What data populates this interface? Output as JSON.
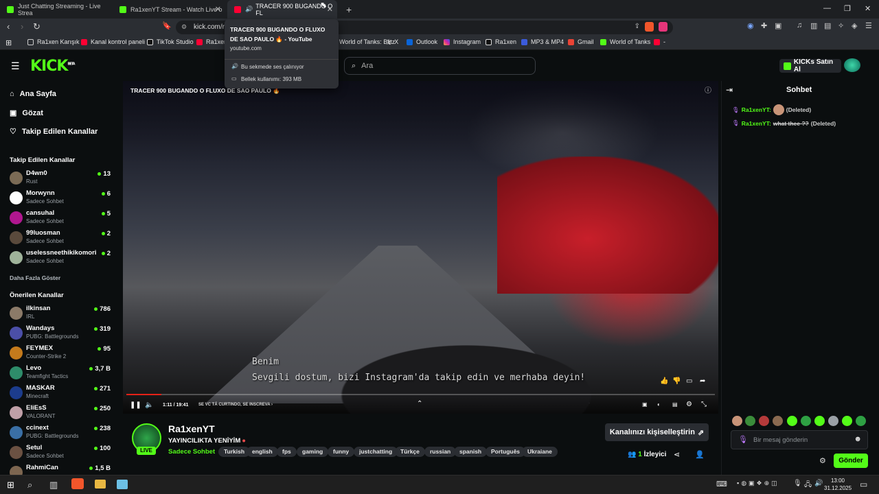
{
  "browser": {
    "tabs": [
      {
        "title": "Just Chatting Streaming - Live Strea",
        "color": "#53fc18"
      },
      {
        "title": "Ra1xenYT Stream - Watch Live o",
        "color": "#53fc18"
      },
      {
        "title": "TRACER 900 BUGANDO O FL",
        "color": "#ff0033"
      }
    ],
    "new_tab_label": "+",
    "url": "kick.com/ra",
    "bookmarks": [
      "Ra1xen Karışık",
      "Kanal kontrol paneli",
      "TikTok Studio",
      "Ra1xen",
      "World of Tanks: Blitz",
      "X",
      "Outlook",
      "Instagram",
      "Ra1xen",
      "MP3 & MP4",
      "Gmail",
      "World of Tanks",
      "-"
    ]
  },
  "tooltip": {
    "title": "TRACER 900 BUGANDO O FLUXO DE SAO PAULO 🔥 - YouTube",
    "site": "youtube.com",
    "audio": "Bu sekmede ses çalınıyor",
    "memory": "Bellek kullanımı: 393 MB"
  },
  "header": {
    "logo": "KICK",
    "logo_badge": "BETA",
    "search_placeholder": "Ara",
    "kicks_button": "KICKs Satın Al"
  },
  "sidebar": {
    "nav": [
      "Ana Sayfa",
      "Gözat",
      "Takip Edilen Kanallar"
    ],
    "followed_heading": "Takip Edilen Kanallar",
    "followed": [
      {
        "name": "D4wn0",
        "category": "Rust",
        "viewers": "13"
      },
      {
        "name": "Morwynn",
        "category": "Sadece Sohbet",
        "viewers": "6"
      },
      {
        "name": "cansuhal",
        "category": "Sadece Sohbet",
        "viewers": "5"
      },
      {
        "name": "99luosman",
        "category": "Sadece Sohbet",
        "viewers": "2"
      },
      {
        "name": "uselessneethikikomori",
        "category": "Sadece Sohbet",
        "viewers": "2"
      }
    ],
    "show_more": "Daha Fazla Göster",
    "recommended_heading": "Önerilen Kanallar",
    "recommended": [
      {
        "name": "ilkinsan",
        "category": "IRL",
        "viewers": "786"
      },
      {
        "name": "Wandays",
        "category": "PUBG: Battlegrounds",
        "viewers": "319"
      },
      {
        "name": "FEYMEX",
        "category": "Counter-Strike 2",
        "viewers": "95"
      },
      {
        "name": "Levo",
        "category": "Teamfight Tactics",
        "viewers": "3,7 B"
      },
      {
        "name": "MASKAR",
        "category": "Minecraft",
        "viewers": "271"
      },
      {
        "name": "EliEsS",
        "category": "VALORANT",
        "viewers": "250"
      },
      {
        "name": "ccinext",
        "category": "PUBG: Battlegrounds",
        "viewers": "238"
      },
      {
        "name": "Setul",
        "category": "Sadece Sohbet",
        "viewers": "100"
      },
      {
        "name": "RahmiCan",
        "category": "",
        "viewers": "1,5 B"
      }
    ]
  },
  "video": {
    "title": "TRACER 900 BUGANDO O FLUXO DE SAO PAULO 🔥",
    "subtitle_line1": "Benim",
    "subtitle_line2": "Sevgili dostum, bizi Instagram'da takip edin ve merhaba deyin!",
    "time": "1:11 / 19:41",
    "chapter": "SE VC TÁ CURTINDO, SE INSCREVA ›",
    "progress": 0.06
  },
  "stream": {
    "streamer": "Ra1xenYT",
    "title": "YAYINCILIKTA YENİYİM",
    "category": "Sadece Sohbet",
    "live_badge": "LIVE",
    "tags": [
      "Turkish",
      "english",
      "fps",
      "gaming",
      "funny",
      "justchatting",
      "Türkçe",
      "russian",
      "spanish",
      "Português",
      "Ukraiane"
    ],
    "customize_button": "Kanalınızı kişiselleştirin",
    "viewer_count": "1",
    "viewer_label": "İzleyici"
  },
  "chat": {
    "title": "Sohbet",
    "messages": [
      {
        "user": "Ra1xenYT:",
        "text": "",
        "deleted": "(Deleted)"
      },
      {
        "user": "Ra1xenYT:",
        "text": "what thee ??",
        "deleted": "(Deleted)"
      }
    ],
    "input_placeholder": "Bir mesaj gönderin",
    "send_button": "Gönder"
  },
  "taskbar": {
    "time": "13:00",
    "date": "31.12.2025"
  },
  "colors": {
    "kick_green": "#53fc18",
    "background": "#0b0e0f",
    "youtube_red": "#ff0033"
  }
}
